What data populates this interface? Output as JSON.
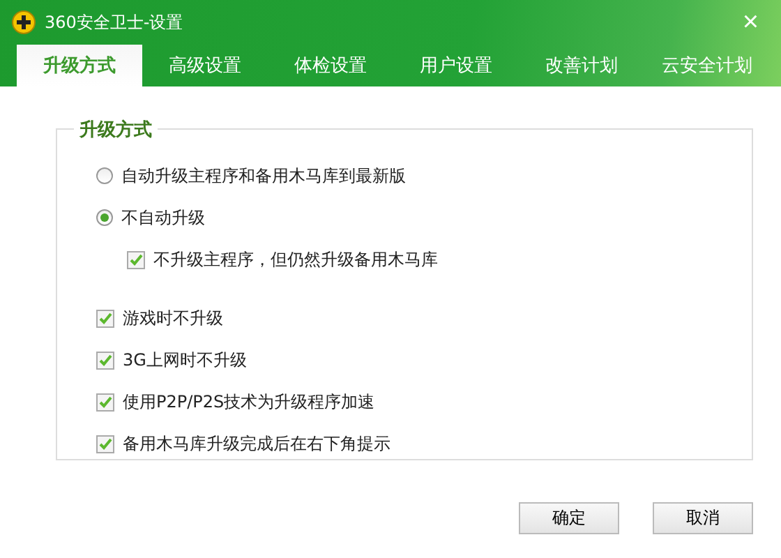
{
  "window": {
    "title": "360安全卫士-设置",
    "close": "×"
  },
  "tabs": [
    {
      "label": "升级方式",
      "selected": true
    },
    {
      "label": "高级设置",
      "selected": false
    },
    {
      "label": "体检设置",
      "selected": false
    },
    {
      "label": "用户设置",
      "selected": false
    },
    {
      "label": "改善计划",
      "selected": false
    },
    {
      "label": "云安全计划",
      "selected": false
    }
  ],
  "group": {
    "title": "升级方式",
    "options": [
      {
        "kind": "radio",
        "label": "自动升级主程序和备用木马库到最新版",
        "selected": false
      },
      {
        "kind": "radio",
        "label": "不自动升级",
        "selected": true,
        "children": [
          {
            "kind": "checkbox",
            "label": "不升级主程序，但仍然升级备用木马库",
            "checked": true
          }
        ]
      }
    ],
    "checkboxes": [
      {
        "kind": "checkbox",
        "label": "游戏时不升级",
        "checked": true
      },
      {
        "kind": "checkbox",
        "label": "3G上网时不升级",
        "checked": true
      },
      {
        "kind": "checkbox",
        "label": "使用P2P/P2S技术为升级程序加速",
        "checked": true
      },
      {
        "kind": "checkbox",
        "label": "备用木马库升级完成后在右下角提示",
        "checked": true
      }
    ]
  },
  "buttons": [
    "确定",
    "取消"
  ]
}
